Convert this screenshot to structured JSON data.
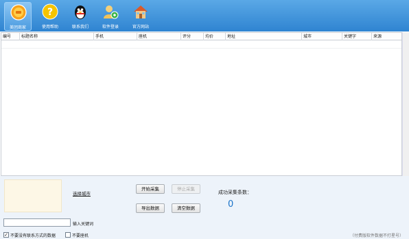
{
  "toolbar": {
    "items": [
      {
        "label": "美团商家",
        "icon": "meituan-logo-icon",
        "active": true
      },
      {
        "label": "使用帮助",
        "icon": "help-question-icon"
      },
      {
        "label": "联系我们",
        "icon": "qq-penguin-icon"
      },
      {
        "label": "软件登录",
        "icon": "user-login-icon"
      },
      {
        "label": "官方网站",
        "icon": "house-icon"
      }
    ]
  },
  "table": {
    "columns": [
      "编号",
      "标题名称",
      "手机",
      "座机",
      "评分",
      "均价",
      "地址",
      "城市",
      "关键字",
      "来源"
    ],
    "rows": []
  },
  "controls": {
    "select_city": "选择城市",
    "start": "开始采集",
    "stop": "停止采集",
    "export": "导出数据",
    "clear": "清空数据",
    "success_label": "成功采集条数：",
    "success_count": "0",
    "keyword_value": "",
    "keyword_label": "输入关键词",
    "opt_no_contact": "不要没有联系方式的数据",
    "opt_no_landline": "不要座机",
    "note": "（付费版软件数据不打星号）"
  },
  "colors": {
    "toolbar": "#3a8fd8",
    "panel": "#edf3fa",
    "count": "#1a73c8"
  }
}
